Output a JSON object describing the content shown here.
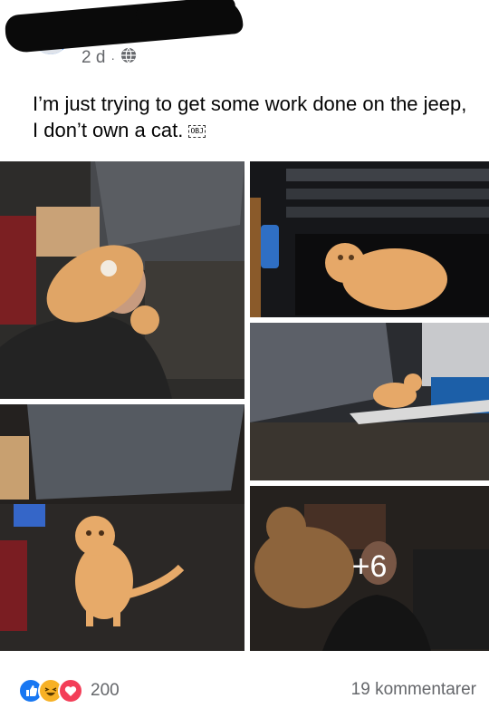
{
  "post": {
    "time": "2 d",
    "separator": "·",
    "text": "I’m just trying to get some work done on the jeep, I don’t own a cat.",
    "text_badge": "OBJ"
  },
  "photos": {
    "more_count": "+6"
  },
  "footer": {
    "reaction_count": "200",
    "comments": "19 kommentarer"
  },
  "icons": {
    "privacy": "globe-icon",
    "reactions": [
      "like-icon",
      "haha-icon",
      "love-icon"
    ]
  }
}
